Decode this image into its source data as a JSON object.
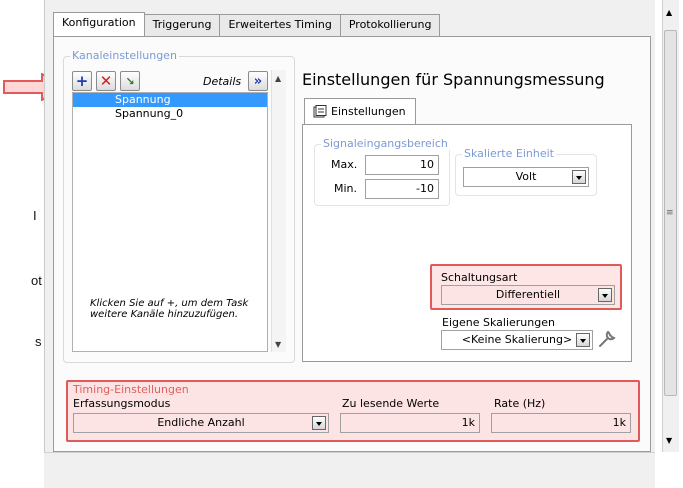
{
  "left_fragments": [
    "I",
    "ot",
    "s"
  ],
  "tabs": [
    {
      "label": "Konfiguration",
      "active": true
    },
    {
      "label": "Triggerung",
      "active": false
    },
    {
      "label": "Erweitertes Timing",
      "active": false
    },
    {
      "label": "Protokollierung",
      "active": false
    }
  ],
  "channel_group": {
    "title": "Kanaleinstellungen",
    "details_label": "Details",
    "details_icon": "double-chevron-right-icon",
    "channels": [
      "Spannung",
      "Spannung_0"
    ],
    "selected_index": 0,
    "hint": "Klicken Sie auf +, um dem Task weitere Kanäle hinzuzufügen."
  },
  "settings": {
    "title": "Einstellungen für Spannungsmessung",
    "subtab_label": "Einstellungen",
    "signal_range": {
      "title": "Signaleingangsbereich",
      "max_label": "Max.",
      "max_value": "10",
      "min_label": "Min.",
      "min_value": "-10"
    },
    "scaled_unit": {
      "title": "Skalierte Einheit",
      "value": "Volt"
    },
    "circuit": {
      "label": "Schaltungsart",
      "value": "Differentiell"
    },
    "custom_scaling": {
      "label": "Eigene Skalierungen",
      "value": "<Keine Skalierung>"
    }
  },
  "timing": {
    "title": "Timing-Einstellungen",
    "mode_label": "Erfassungsmodus",
    "mode_value": "Endliche Anzahl",
    "samples_label": "Zu lesende Werte",
    "samples_value": "1k",
    "rate_label": "Rate (Hz)",
    "rate_value": "1k"
  },
  "colors": {
    "highlight": "#e05a5a",
    "selection": "#3399ff",
    "group_title": "#7b9bd4"
  }
}
